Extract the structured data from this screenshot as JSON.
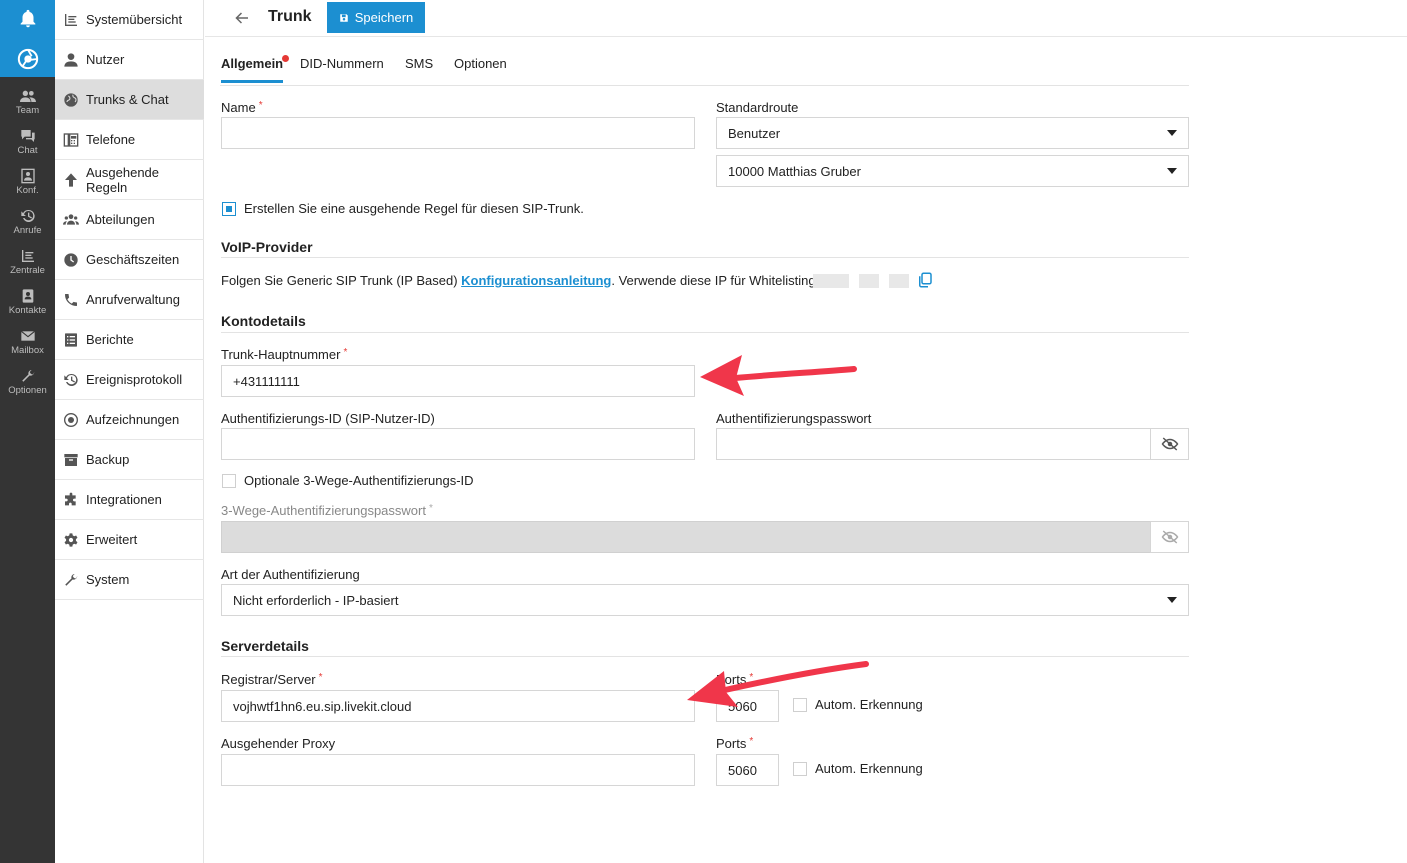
{
  "rail": {
    "items": [
      {
        "label": "Team",
        "icon": "team-icon"
      },
      {
        "label": "Chat",
        "icon": "chat-icon"
      },
      {
        "label": "Konf.",
        "icon": "conference-icon"
      },
      {
        "label": "Anrufe",
        "icon": "history-icon"
      },
      {
        "label": "Zentrale",
        "icon": "switchboard-icon"
      },
      {
        "label": "Kontakte",
        "icon": "contacts-icon"
      },
      {
        "label": "Mailbox",
        "icon": "mail-icon"
      },
      {
        "label": "Optionen",
        "icon": "wrench-icon"
      }
    ]
  },
  "sidebar": {
    "items": [
      {
        "label": "Systemübersicht"
      },
      {
        "label": "Nutzer"
      },
      {
        "label": "Trunks & Chat",
        "active": true
      },
      {
        "label": "Telefone"
      },
      {
        "label": "Ausgehende Regeln"
      },
      {
        "label": "Abteilungen"
      },
      {
        "label": "Geschäftszeiten"
      },
      {
        "label": "Anrufverwaltung"
      },
      {
        "label": "Berichte"
      },
      {
        "label": "Ereignisprotokoll"
      },
      {
        "label": "Aufzeichnungen"
      },
      {
        "label": "Backup"
      },
      {
        "label": "Integrationen"
      },
      {
        "label": "Erweitert"
      },
      {
        "label": "System"
      }
    ]
  },
  "header": {
    "title": "Trunk",
    "save_label": "Speichern"
  },
  "tabs": [
    "Allgemein",
    "DID-Nummern",
    "SMS",
    "Optionen"
  ],
  "form": {
    "name_label": "Name",
    "name_value": "",
    "default_route_label": "Standardroute",
    "default_route_type": "Benutzer",
    "default_route_target": "10000 Matthias Gruber",
    "outbound_rule_label": "Erstellen Sie eine ausgehende Regel für diesen SIP-Trunk.",
    "outbound_rule_checked": true,
    "voip_section": "VoIP-Provider",
    "voip_info_prefix": "Folgen Sie Generic SIP Trunk (IP Based) ",
    "voip_info_link": "Konfigurationsanleitung",
    "voip_info_suffix": ". Verwende diese IP für Whitelisting",
    "account_section": "Kontodetails",
    "main_number_label": "Trunk-Hauptnummer",
    "main_number_value": "+431111111",
    "auth_id_label": "Authentifizierungs-ID (SIP-Nutzer-ID)",
    "auth_id_value": "",
    "auth_pw_label": "Authentifizierungspasswort",
    "auth_pw_value": "",
    "three_way_label": "Optionale 3-Wege-Authentifizierungs-ID",
    "three_way_checked": false,
    "three_way_pw_label": "3-Wege-Authentifizierungspasswort",
    "auth_type_label": "Art der Authentifizierung",
    "auth_type_value": "Nicht erforderlich - IP-basiert",
    "server_section": "Serverdetails",
    "registrar_label": "Registrar/Server",
    "registrar_value": "vojhwtf1hn6.eu.sip.livekit.cloud",
    "ports_label": "Ports",
    "registrar_port": "5060",
    "auto_detect_label": "Autom. Erkennung",
    "proxy_label": "Ausgehender Proxy",
    "proxy_value": "",
    "proxy_ports_label": "Ports",
    "proxy_port": "5060",
    "proxy_auto_detect_label": "Autom. Erkennung"
  },
  "colors": {
    "accent": "#1c8fd1",
    "rail": "#343434",
    "required": "#e53935",
    "annotation_arrow": "#f0364a"
  }
}
